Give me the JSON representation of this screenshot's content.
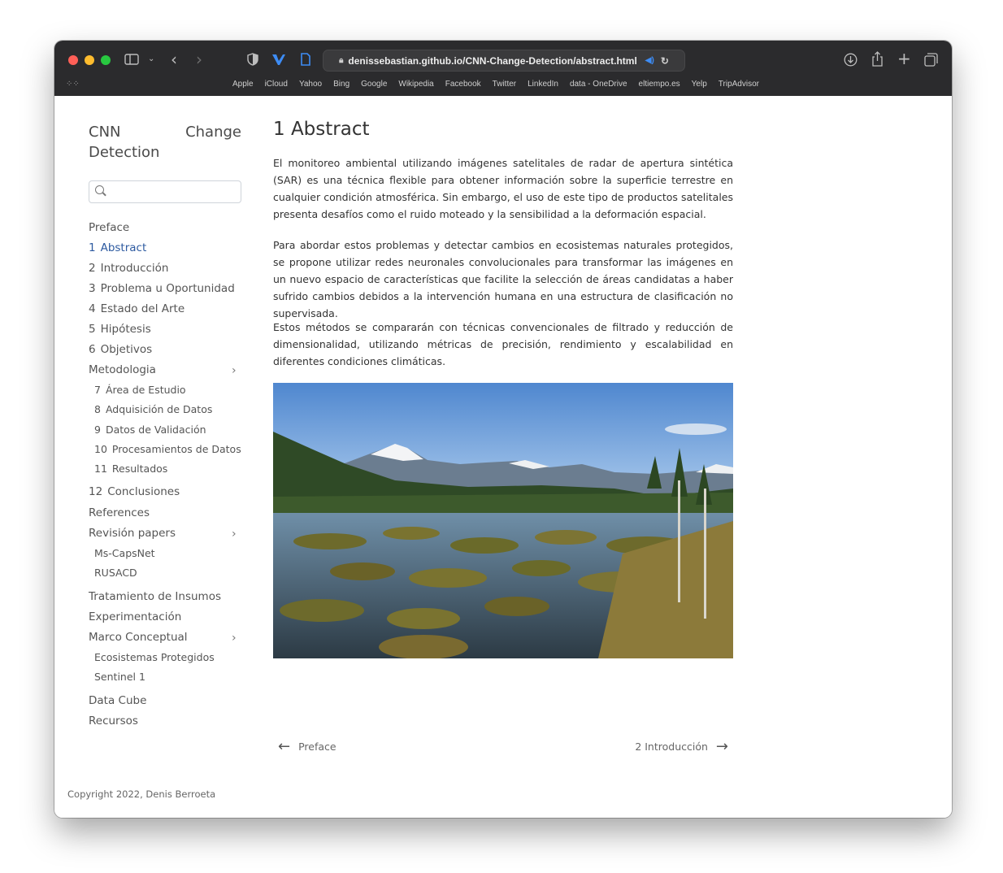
{
  "browser": {
    "url": "denissebastian.github.io/CNN-Change-Detection/abstract.html",
    "favorites": [
      "Apple",
      "iCloud",
      "Yahoo",
      "Bing",
      "Google",
      "Wikipedia",
      "Facebook",
      "Twitter",
      "LinkedIn",
      "data - OneDrive",
      "eltiempo.es",
      "Yelp",
      "TripAdvisor"
    ],
    "traffic_light_colors": {
      "close": "#ff5f57",
      "minimize": "#febc2e",
      "zoom": "#28c840"
    }
  },
  "sidebar": {
    "title_line1_a": "CNN",
    "title_line1_b": "Change",
    "title_line2": "Detection",
    "search_placeholder": "",
    "nav": [
      {
        "num": "",
        "label": "Preface"
      },
      {
        "num": "1",
        "label": "Abstract",
        "active": true
      },
      {
        "num": "2",
        "label": "Introducción"
      },
      {
        "num": "3",
        "label": "Problema u Oportunidad"
      },
      {
        "num": "4",
        "label": "Estado del Arte"
      },
      {
        "num": "5",
        "label": "Hipótesis"
      },
      {
        "num": "6",
        "label": "Objetivos"
      },
      {
        "num": "",
        "label": "Metodologia",
        "expandable": true
      },
      {
        "num": "7",
        "label": "Área de Estudio",
        "sub": true
      },
      {
        "num": "8",
        "label": "Adquisición de Datos",
        "sub": true
      },
      {
        "num": "9",
        "label": "Datos de Validación",
        "sub": true
      },
      {
        "num": "10",
        "label": "Procesamientos de Datos",
        "sub": true
      },
      {
        "num": "11",
        "label": "Resultados",
        "sub": true
      },
      {
        "num": "12",
        "label": "Conclusiones"
      },
      {
        "num": "",
        "label": "References"
      },
      {
        "num": "",
        "label": "Revisión papers",
        "expandable": true
      },
      {
        "num": "",
        "label": "Ms-CapsNet",
        "sub": true
      },
      {
        "num": "",
        "label": "RUSACD",
        "sub": true
      },
      {
        "num": "",
        "label": "Tratamiento de Insumos"
      },
      {
        "num": "",
        "label": "Experimentación"
      },
      {
        "num": "",
        "label": "Marco Conceptual",
        "expandable": true
      },
      {
        "num": "",
        "label": "Ecosistemas Protegidos",
        "sub": true
      },
      {
        "num": "",
        "label": "Sentinel 1",
        "sub": true
      },
      {
        "num": "",
        "label": "Data Cube"
      },
      {
        "num": "",
        "label": "Recursos"
      }
    ],
    "copyright": "Copyright 2022, Denis Berroeta"
  },
  "main": {
    "title_num": "1",
    "title": "Abstract",
    "paragraphs": [
      "El monitoreo ambiental utilizando imágenes satelitales de radar de apertura sintética (SAR) es una técnica flexible para obtener información sobre la superficie terrestre en cualquier condición atmosférica. Sin embargo, el uso de este tipo de productos satelitales presenta desafíos como el ruido moteado y la sensibilidad a la deformación espacial.",
      "Para abordar estos problemas y detectar cambios en ecosistemas naturales protegidos, se propone utilizar redes neuronales convolucionales para transformar las imágenes en un nuevo espacio de características que facilite la selección de áreas candidatas a haber sufrido cambios debidos a la intervención humana en una estructura de clasificación no supervisada.",
      "Estos métodos se compararán con técnicas convencionales de filtrado y reducción de dimensionalidad, utilizando métricas de precisión, rendimiento y escalabilidad en diferentes condiciones climáticas."
    ],
    "prev_label": "Preface",
    "next_label": "2  Introducción"
  }
}
